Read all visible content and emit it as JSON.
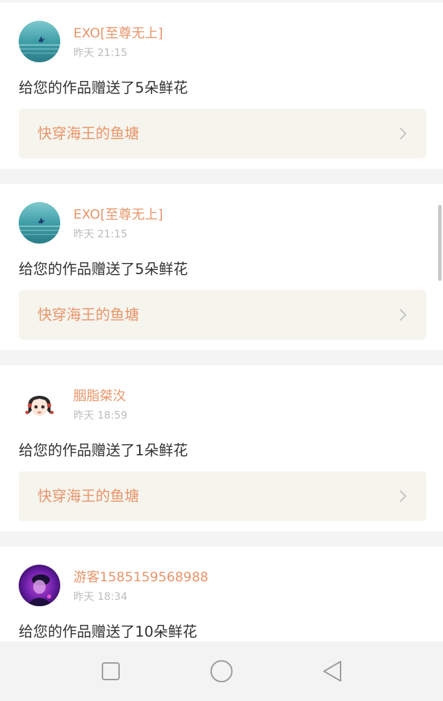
{
  "colors": {
    "accent": "#e8956a",
    "time": "#bcbcbc",
    "text": "#333333",
    "card_link_bg": "#f5f4ed",
    "page_bg": "#f4f4f4"
  },
  "notifications": [
    {
      "user_name": "EXO[至尊无上]",
      "time": "昨天 21:15",
      "message": "给您的作品赠送了5朵鲜花",
      "book_title": "快穿海王的鱼塘",
      "avatar_icon": "whale-ocean-avatar"
    },
    {
      "user_name": "EXO[至尊无上]",
      "time": "昨天 21:15",
      "message": "给您的作品赠送了5朵鲜花",
      "book_title": "快穿海王的鱼塘",
      "avatar_icon": "whale-ocean-avatar"
    },
    {
      "user_name": "胭脂桀汷",
      "time": "昨天 18:59",
      "message": "给您的作品赠送了1朵鲜花",
      "book_title": "快穿海王的鱼塘",
      "avatar_icon": "anime-girl-avatar"
    },
    {
      "user_name": "游客1585159568988",
      "time": "昨天 18:34",
      "message": "给您的作品赠送了10朵鲜花",
      "avatar_icon": "purple-portrait-avatar"
    }
  ],
  "nav_bar": {
    "recent_icon": "square-icon",
    "home_icon": "circle-icon",
    "back_icon": "triangle-back-icon"
  }
}
